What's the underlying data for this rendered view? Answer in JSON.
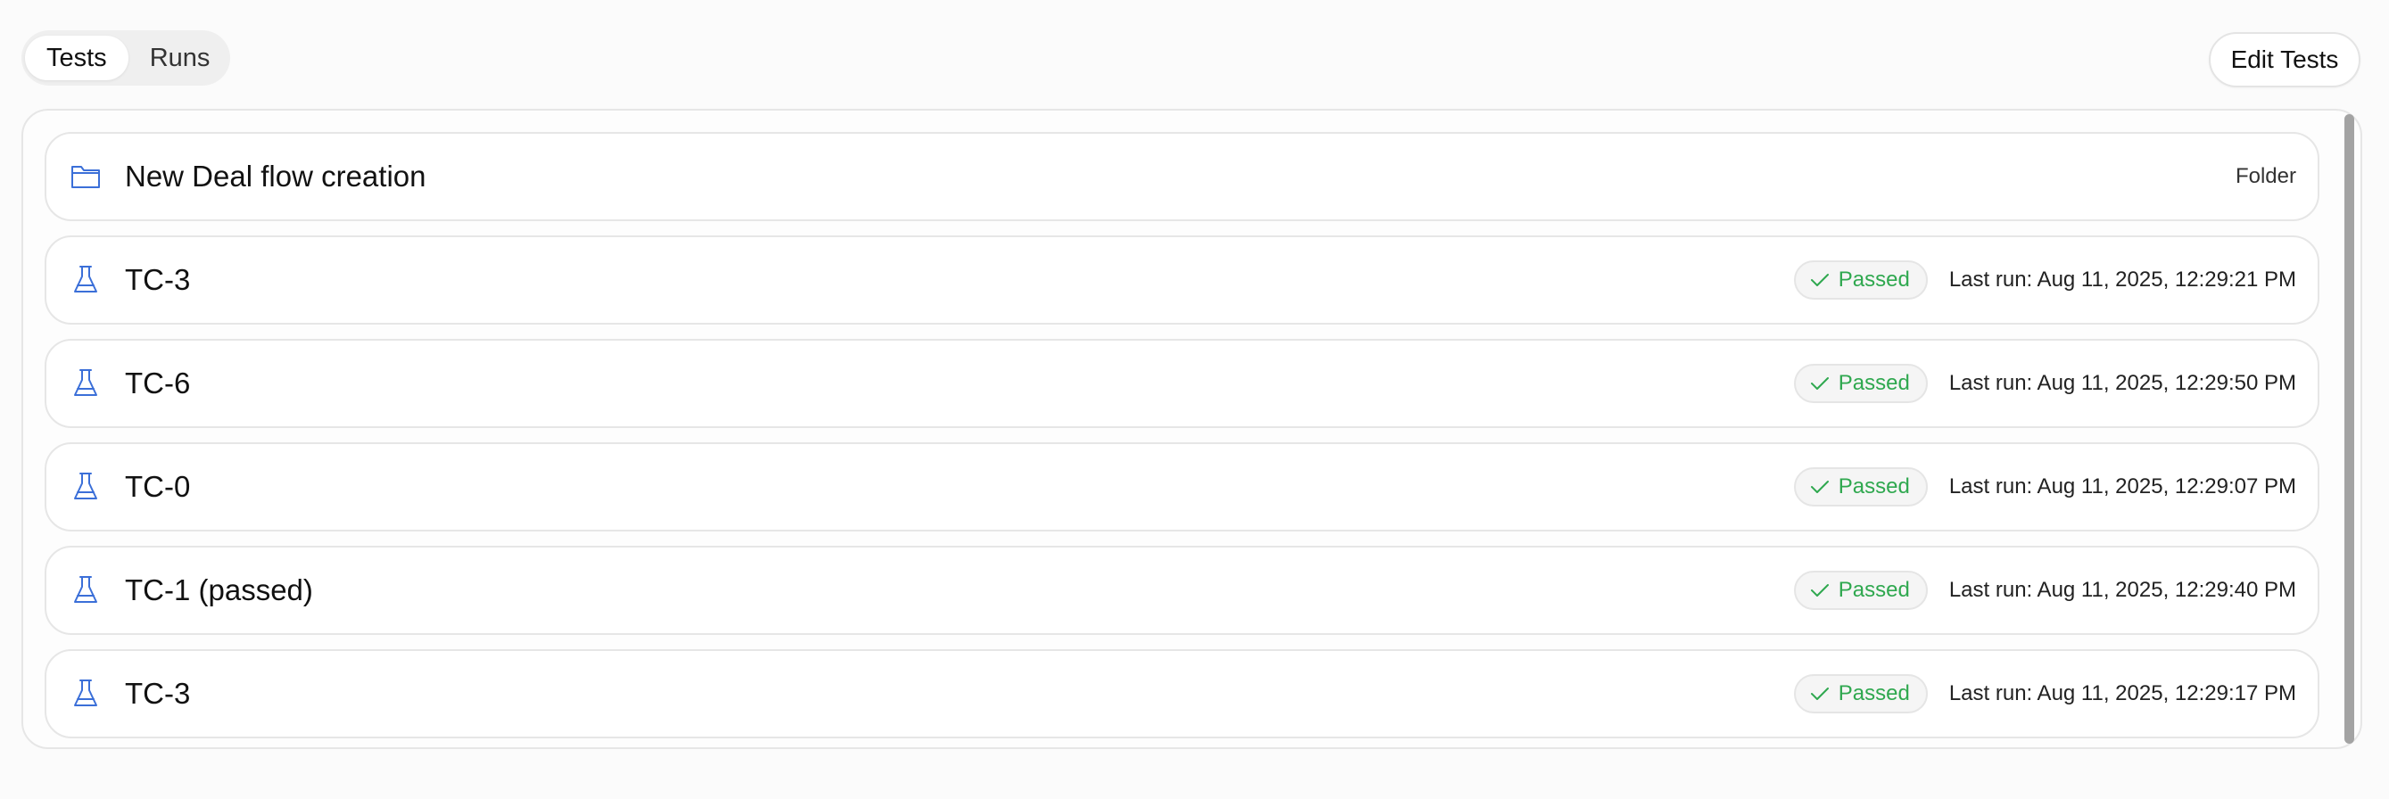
{
  "tabs": [
    {
      "label": "Tests",
      "active": true
    },
    {
      "label": "Runs",
      "active": false
    }
  ],
  "toolbar": {
    "edit_label": "Edit Tests"
  },
  "colors": {
    "icon_blue": "#3b6fd8",
    "passed_green": "#2fa84f"
  },
  "folder": {
    "name": "New Deal flow creation",
    "type_label": "Folder",
    "icon": "folder-icon"
  },
  "tests": [
    {
      "name": "TC-3",
      "status": "Passed",
      "last_run": "Last run: Aug 11, 2025, 12:29:21 PM",
      "icon": "flask-icon"
    },
    {
      "name": "TC-6",
      "status": "Passed",
      "last_run": "Last run: Aug 11, 2025, 12:29:50 PM",
      "icon": "flask-icon"
    },
    {
      "name": "TC-0",
      "status": "Passed",
      "last_run": "Last run: Aug 11, 2025, 12:29:07 PM",
      "icon": "flask-icon"
    },
    {
      "name": "TC-1 (passed)",
      "status": "Passed",
      "last_run": "Last run: Aug 11, 2025, 12:29:40 PM",
      "icon": "flask-icon"
    },
    {
      "name": "TC-3",
      "status": "Passed",
      "last_run": "Last run: Aug 11, 2025, 12:29:17 PM",
      "icon": "flask-icon"
    }
  ]
}
